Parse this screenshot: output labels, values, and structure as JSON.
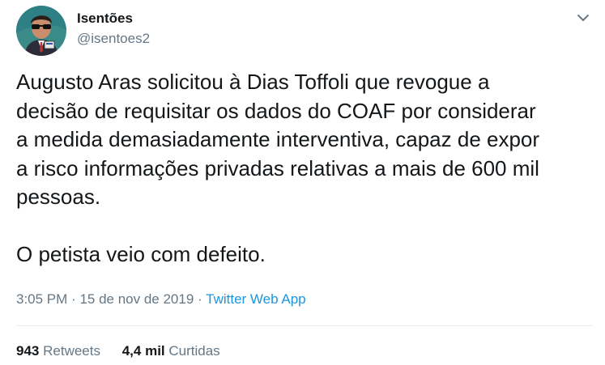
{
  "author": {
    "name": "Isentões",
    "handle": "@isentoes2",
    "avatar": "avatar-icon"
  },
  "tweet": {
    "lines": [
      "Augusto Aras solicitou à Dias Toffoli que revogue a",
      "decisão de requisitar os dados do COAF por considerar",
      "a medida demasiadamente interventiva, capaz de expor",
      "a risco informações privadas relativas a mais de 600 mil",
      "pessoas.",
      "O petista veio com defeito."
    ]
  },
  "meta": {
    "time": "3:05 PM",
    "separator": "·",
    "date": "15 de nov de 2019",
    "app": "Twitter Web App"
  },
  "stats": {
    "retweets_count": "943",
    "retweets_label": "Retweets",
    "likes_count": "4,4 mil",
    "likes_label": "Curtidas"
  },
  "colors": {
    "text": "#14171a",
    "secondary": "#657786",
    "link": "#1b95e0",
    "divider": "#e6ecf0"
  },
  "icons": {
    "caret": "chevron-down-icon"
  }
}
